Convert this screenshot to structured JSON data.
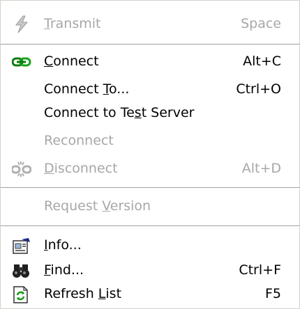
{
  "menu": {
    "items": [
      {
        "label_pre": "",
        "label_mn": "T",
        "label_post": "ransmit",
        "shortcut": "Space",
        "icon": "lightning-icon",
        "enabled": false
      },
      {
        "label_pre": "",
        "label_mn": "C",
        "label_post": "onnect",
        "shortcut": "Alt+C",
        "icon": "connect-icon",
        "enabled": true
      },
      {
        "label_pre": "Connect ",
        "label_mn": "T",
        "label_post": "o...",
        "shortcut": "Ctrl+O",
        "icon": "",
        "enabled": true
      },
      {
        "label_pre": "Connect to Te",
        "label_mn": "s",
        "label_post": "t Server",
        "shortcut": "",
        "icon": "",
        "enabled": true
      },
      {
        "label_pre": "Reconnect",
        "label_mn": "",
        "label_post": "",
        "shortcut": "",
        "icon": "",
        "enabled": false
      },
      {
        "label_pre": "",
        "label_mn": "D",
        "label_post": "isconnect",
        "shortcut": "Alt+D",
        "icon": "disconnect-icon",
        "enabled": false
      },
      {
        "label_pre": "Request ",
        "label_mn": "V",
        "label_post": "ersion",
        "shortcut": "",
        "icon": "",
        "enabled": false
      },
      {
        "label_pre": "",
        "label_mn": "I",
        "label_post": "nfo...",
        "shortcut": "",
        "icon": "info-icon",
        "enabled": true
      },
      {
        "label_pre": "",
        "label_mn": "F",
        "label_post": "ind...",
        "shortcut": "Ctrl+F",
        "icon": "binoculars-icon",
        "enabled": true
      },
      {
        "label_pre": "Refresh ",
        "label_mn": "L",
        "label_post": "ist",
        "shortcut": "F5",
        "icon": "refresh-icon",
        "enabled": true
      }
    ]
  },
  "colors": {
    "enabled_text": "#000000",
    "disabled_text": "#a7a7a7",
    "separator": "#a0a0a0",
    "connect_icon": "#16a316",
    "refresh_icon": "#1a9a1a"
  }
}
